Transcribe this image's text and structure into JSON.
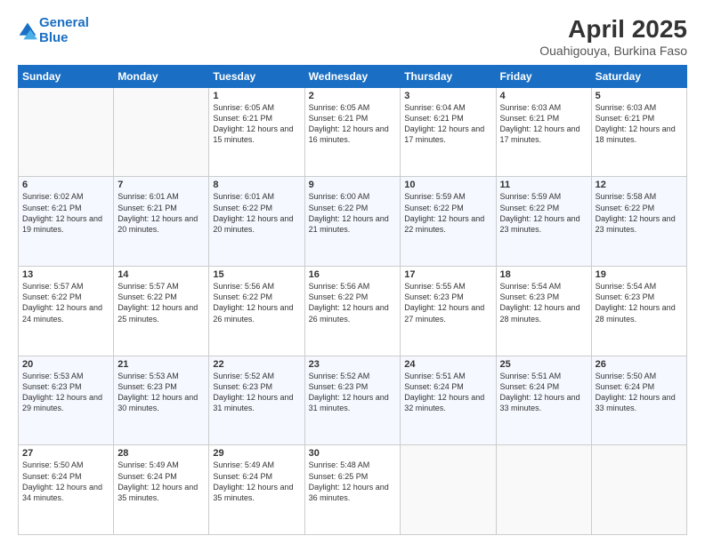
{
  "header": {
    "logo_line1": "General",
    "logo_line2": "Blue",
    "title": "April 2025",
    "subtitle": "Ouahigouya, Burkina Faso"
  },
  "weekdays": [
    "Sunday",
    "Monday",
    "Tuesday",
    "Wednesday",
    "Thursday",
    "Friday",
    "Saturday"
  ],
  "weeks": [
    [
      {
        "day": "",
        "sunrise": "",
        "sunset": "",
        "daylight": ""
      },
      {
        "day": "",
        "sunrise": "",
        "sunset": "",
        "daylight": ""
      },
      {
        "day": "1",
        "sunrise": "Sunrise: 6:05 AM",
        "sunset": "Sunset: 6:21 PM",
        "daylight": "Daylight: 12 hours and 15 minutes."
      },
      {
        "day": "2",
        "sunrise": "Sunrise: 6:05 AM",
        "sunset": "Sunset: 6:21 PM",
        "daylight": "Daylight: 12 hours and 16 minutes."
      },
      {
        "day": "3",
        "sunrise": "Sunrise: 6:04 AM",
        "sunset": "Sunset: 6:21 PM",
        "daylight": "Daylight: 12 hours and 17 minutes."
      },
      {
        "day": "4",
        "sunrise": "Sunrise: 6:03 AM",
        "sunset": "Sunset: 6:21 PM",
        "daylight": "Daylight: 12 hours and 17 minutes."
      },
      {
        "day": "5",
        "sunrise": "Sunrise: 6:03 AM",
        "sunset": "Sunset: 6:21 PM",
        "daylight": "Daylight: 12 hours and 18 minutes."
      }
    ],
    [
      {
        "day": "6",
        "sunrise": "Sunrise: 6:02 AM",
        "sunset": "Sunset: 6:21 PM",
        "daylight": "Daylight: 12 hours and 19 minutes."
      },
      {
        "day": "7",
        "sunrise": "Sunrise: 6:01 AM",
        "sunset": "Sunset: 6:21 PM",
        "daylight": "Daylight: 12 hours and 20 minutes."
      },
      {
        "day": "8",
        "sunrise": "Sunrise: 6:01 AM",
        "sunset": "Sunset: 6:22 PM",
        "daylight": "Daylight: 12 hours and 20 minutes."
      },
      {
        "day": "9",
        "sunrise": "Sunrise: 6:00 AM",
        "sunset": "Sunset: 6:22 PM",
        "daylight": "Daylight: 12 hours and 21 minutes."
      },
      {
        "day": "10",
        "sunrise": "Sunrise: 5:59 AM",
        "sunset": "Sunset: 6:22 PM",
        "daylight": "Daylight: 12 hours and 22 minutes."
      },
      {
        "day": "11",
        "sunrise": "Sunrise: 5:59 AM",
        "sunset": "Sunset: 6:22 PM",
        "daylight": "Daylight: 12 hours and 23 minutes."
      },
      {
        "day": "12",
        "sunrise": "Sunrise: 5:58 AM",
        "sunset": "Sunset: 6:22 PM",
        "daylight": "Daylight: 12 hours and 23 minutes."
      }
    ],
    [
      {
        "day": "13",
        "sunrise": "Sunrise: 5:57 AM",
        "sunset": "Sunset: 6:22 PM",
        "daylight": "Daylight: 12 hours and 24 minutes."
      },
      {
        "day": "14",
        "sunrise": "Sunrise: 5:57 AM",
        "sunset": "Sunset: 6:22 PM",
        "daylight": "Daylight: 12 hours and 25 minutes."
      },
      {
        "day": "15",
        "sunrise": "Sunrise: 5:56 AM",
        "sunset": "Sunset: 6:22 PM",
        "daylight": "Daylight: 12 hours and 26 minutes."
      },
      {
        "day": "16",
        "sunrise": "Sunrise: 5:56 AM",
        "sunset": "Sunset: 6:22 PM",
        "daylight": "Daylight: 12 hours and 26 minutes."
      },
      {
        "day": "17",
        "sunrise": "Sunrise: 5:55 AM",
        "sunset": "Sunset: 6:23 PM",
        "daylight": "Daylight: 12 hours and 27 minutes."
      },
      {
        "day": "18",
        "sunrise": "Sunrise: 5:54 AM",
        "sunset": "Sunset: 6:23 PM",
        "daylight": "Daylight: 12 hours and 28 minutes."
      },
      {
        "day": "19",
        "sunrise": "Sunrise: 5:54 AM",
        "sunset": "Sunset: 6:23 PM",
        "daylight": "Daylight: 12 hours and 28 minutes."
      }
    ],
    [
      {
        "day": "20",
        "sunrise": "Sunrise: 5:53 AM",
        "sunset": "Sunset: 6:23 PM",
        "daylight": "Daylight: 12 hours and 29 minutes."
      },
      {
        "day": "21",
        "sunrise": "Sunrise: 5:53 AM",
        "sunset": "Sunset: 6:23 PM",
        "daylight": "Daylight: 12 hours and 30 minutes."
      },
      {
        "day": "22",
        "sunrise": "Sunrise: 5:52 AM",
        "sunset": "Sunset: 6:23 PM",
        "daylight": "Daylight: 12 hours and 31 minutes."
      },
      {
        "day": "23",
        "sunrise": "Sunrise: 5:52 AM",
        "sunset": "Sunset: 6:23 PM",
        "daylight": "Daylight: 12 hours and 31 minutes."
      },
      {
        "day": "24",
        "sunrise": "Sunrise: 5:51 AM",
        "sunset": "Sunset: 6:24 PM",
        "daylight": "Daylight: 12 hours and 32 minutes."
      },
      {
        "day": "25",
        "sunrise": "Sunrise: 5:51 AM",
        "sunset": "Sunset: 6:24 PM",
        "daylight": "Daylight: 12 hours and 33 minutes."
      },
      {
        "day": "26",
        "sunrise": "Sunrise: 5:50 AM",
        "sunset": "Sunset: 6:24 PM",
        "daylight": "Daylight: 12 hours and 33 minutes."
      }
    ],
    [
      {
        "day": "27",
        "sunrise": "Sunrise: 5:50 AM",
        "sunset": "Sunset: 6:24 PM",
        "daylight": "Daylight: 12 hours and 34 minutes."
      },
      {
        "day": "28",
        "sunrise": "Sunrise: 5:49 AM",
        "sunset": "Sunset: 6:24 PM",
        "daylight": "Daylight: 12 hours and 35 minutes."
      },
      {
        "day": "29",
        "sunrise": "Sunrise: 5:49 AM",
        "sunset": "Sunset: 6:24 PM",
        "daylight": "Daylight: 12 hours and 35 minutes."
      },
      {
        "day": "30",
        "sunrise": "Sunrise: 5:48 AM",
        "sunset": "Sunset: 6:25 PM",
        "daylight": "Daylight: 12 hours and 36 minutes."
      },
      {
        "day": "",
        "sunrise": "",
        "sunset": "",
        "daylight": ""
      },
      {
        "day": "",
        "sunrise": "",
        "sunset": "",
        "daylight": ""
      },
      {
        "day": "",
        "sunrise": "",
        "sunset": "",
        "daylight": ""
      }
    ]
  ]
}
